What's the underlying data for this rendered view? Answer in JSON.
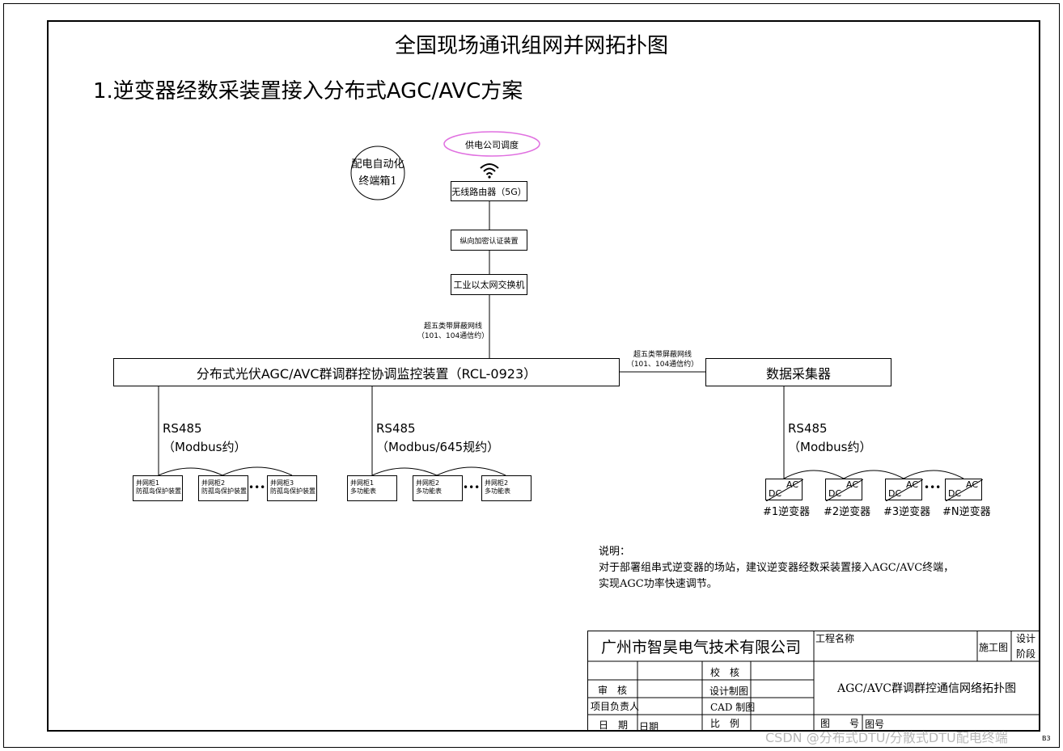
{
  "title": "全国现场通讯组网并网拓扑图",
  "subtitle": "1.逆变器经数采装置接入分布式AGC/AVC方案",
  "seal_text": [
    "配电自动化",
    "终端箱1"
  ],
  "dispatch": "供电公司调度",
  "router": "无线路由器（5G）",
  "encryption": "纵向加密认证装置",
  "switch": "工业以太网交换机",
  "cable_label_1": [
    "超五类带屏蔽网线",
    "（101、104通信约）"
  ],
  "cable_label_2": [
    "超五类带屏蔽网线",
    "（101、104通信约）"
  ],
  "controller": "分布式光伏AGC/AVC群调群控协调监控装置（RCL-0923）",
  "collector": "数据采集器",
  "bus_left": [
    "RS485",
    "（Modbus约）"
  ],
  "bus_mid": [
    "RS485",
    "（Modbus/645规约）"
  ],
  "bus_right": [
    "RS485",
    "（Modbus约）"
  ],
  "ellipsis": "•••",
  "left_devices": [
    {
      "line1": "并网柜1",
      "line2": "防孤岛保护装置"
    },
    {
      "line1": "并网柜2",
      "line2": "防孤岛保护装置"
    },
    {
      "line1": "并网柜3",
      "line2": "防孤岛保护装置"
    }
  ],
  "mid_devices": [
    {
      "line1": "并网柜1",
      "line2": "多功能表"
    },
    {
      "line1": "并网柜2",
      "line2": "多功能表"
    },
    {
      "line1": "并网柜2",
      "line2": "多功能表"
    }
  ],
  "inverter_ac": "AC",
  "inverter_dc": "DC",
  "inverters": [
    "#1逆变器",
    "#2逆变器",
    "#3逆变器",
    "#N逆变器"
  ],
  "notes": {
    "heading": "说明：",
    "line1": "对于部署组串式逆变器的场站，建议逆变器经数采装置接入AGC/AVC终端，",
    "line2": "实现AGC功率快速调节。"
  },
  "title_block": {
    "company": "广州市智昊电气技术有限公司",
    "project_name_label": "工程名称",
    "stage_value": "施工图",
    "stage_label": [
      "设计",
      "阶段"
    ],
    "check": "校　核",
    "review": "审　核",
    "design_drawing": "设计制图",
    "project_lead": "项目负责人",
    "cad_drawing": "CAD 制图",
    "date_label": "日　期",
    "date_value": "日期",
    "scale": "比　例",
    "drawing_title": "AGC/AVC群调群控通信网络拓扑图",
    "drawing_no_label": "图　　号",
    "drawing_no_value": "图号"
  },
  "watermark": "CSDN @分布式DTU/分散式DTU配电终端",
  "corner_mark": "B3"
}
